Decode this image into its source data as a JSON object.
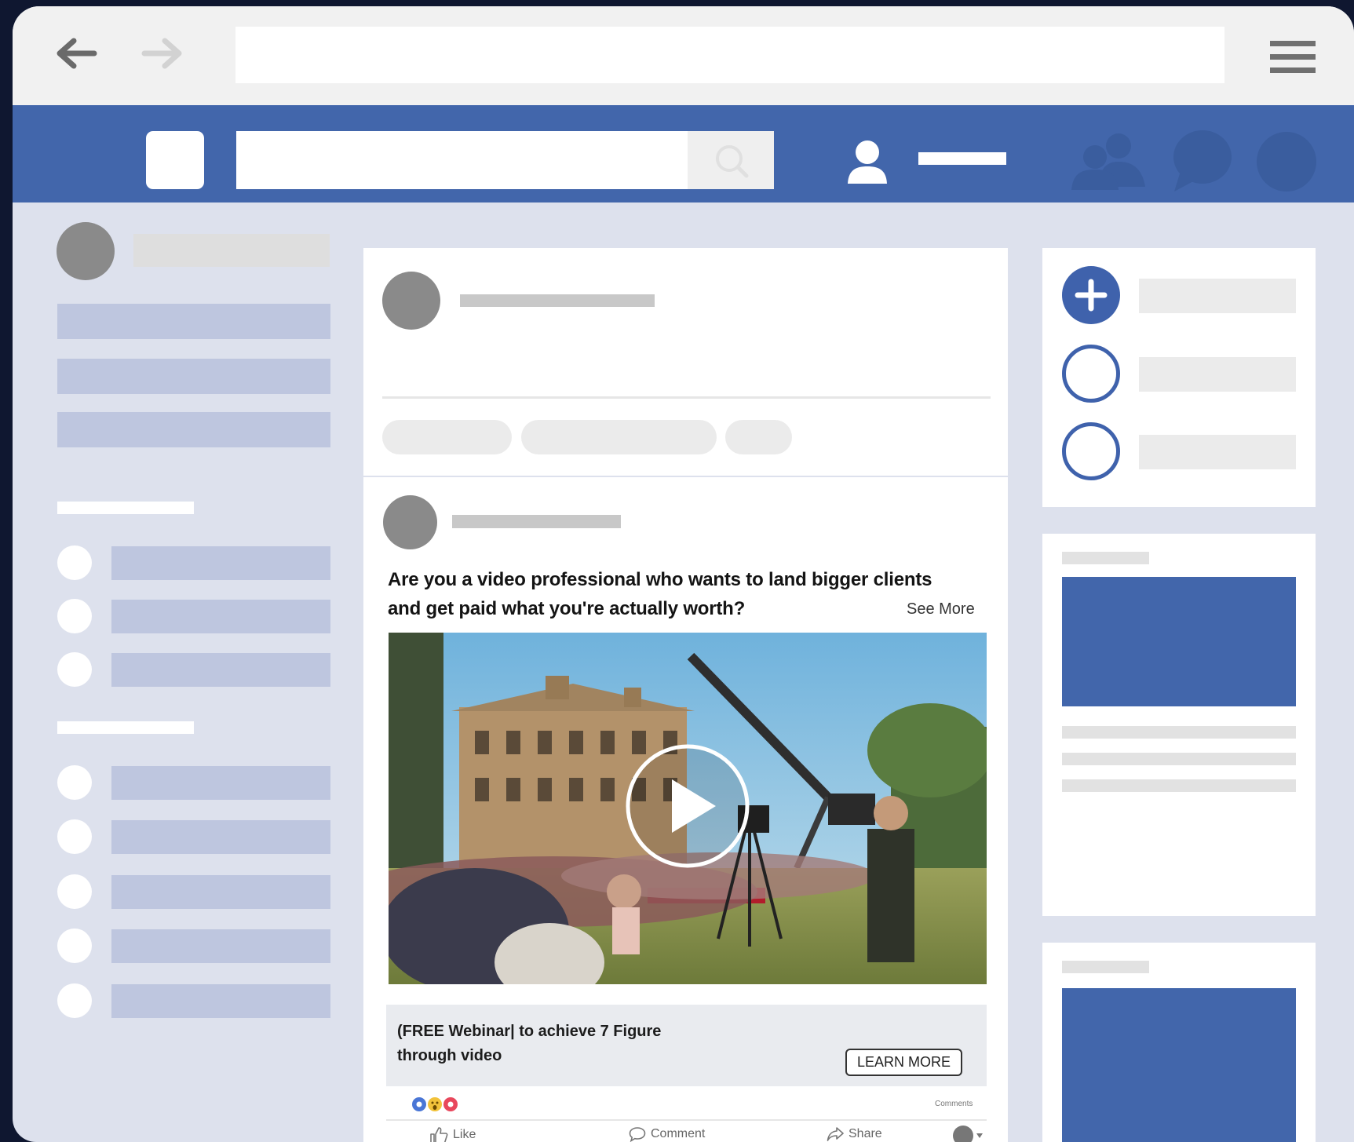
{
  "post": {
    "text_line1": "Are you a video professional who wants to land bigger clients",
    "text_line2": "and get paid what you're actually worth?",
    "see_more": "See More",
    "cta_line1": "(FREE Webinar| to achieve 7 Figure",
    "cta_line2": "through video",
    "learn_more": "LEARN MORE",
    "comments_label": "Comments",
    "actions": {
      "like": "Like",
      "comment": "Comment",
      "share": "Share"
    }
  },
  "colors": {
    "brand_blue": "#4266ab",
    "page_bg": "#dde1ed",
    "placeholder_blue": "#bec6df"
  },
  "icons": [
    "back-arrow-icon",
    "forward-arrow-icon",
    "hamburger-menu-icon",
    "search-icon",
    "profile-icon",
    "friends-icon",
    "messenger-icon",
    "notifications-icon",
    "plus-icon",
    "play-icon",
    "like-icon",
    "comment-icon",
    "share-icon"
  ]
}
